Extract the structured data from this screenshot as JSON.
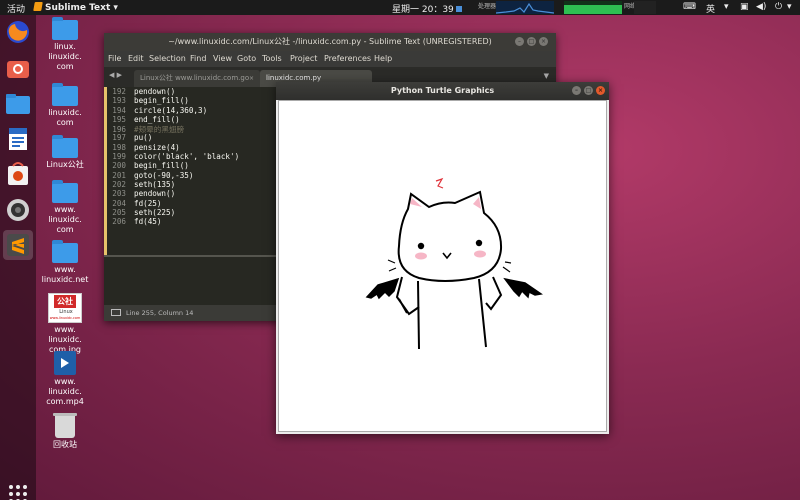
{
  "topbar": {
    "activities": "活动",
    "app_name": "Sublime Text",
    "clock": "星期一 20：39",
    "sysmon_labels": [
      "处理器",
      "网络"
    ],
    "lang": "英"
  },
  "dock": {
    "items": [
      "firefox-icon",
      "screenshot-icon",
      "files-icon",
      "writer-icon",
      "software-icon",
      "camera-icon",
      "sublime-icon"
    ]
  },
  "desktop": {
    "icons": [
      {
        "label": "linux.\nlinuxidc.\ncom",
        "type": "folder"
      },
      {
        "label": "linuxidc.\ncom",
        "type": "folder"
      },
      {
        "label": "Linux公社",
        "type": "folder"
      },
      {
        "label": "www.\nlinuxidc.\ncom",
        "type": "folder"
      },
      {
        "label": "www.\nlinuxidc.net",
        "type": "folder"
      },
      {
        "label": "www.\nlinuxidc.\ncom.jpg",
        "type": "image"
      },
      {
        "label": "www.\nlinuxidc.\ncom.mp4",
        "type": "video"
      },
      {
        "label": "回收站",
        "type": "trash"
      }
    ],
    "image_thumb_text": [
      "公社",
      "Linux",
      "www.linuxidc.com"
    ]
  },
  "sublime": {
    "title": "~/www.linuxidc.com/Linux公社 -/linuxidc.com.py - Sublime Text (UNREGISTERED)",
    "menu": [
      "File",
      "Edit",
      "Selection",
      "Find",
      "View",
      "Goto",
      "Tools",
      "Project",
      "Preferences",
      "Help"
    ],
    "tabs": [
      {
        "label": "Linux公社 www.linuxidc.com.go",
        "active": false
      },
      {
        "label": "linuxidc.com.py",
        "active": true
      }
    ],
    "code_lines": [
      {
        "n": "192",
        "text": "pendown()"
      },
      {
        "n": "193",
        "text": "begin_fill()"
      },
      {
        "n": "194",
        "text": "circle(14,360,3)"
      },
      {
        "n": "195",
        "text": "end_fill()"
      },
      {
        "n": "196",
        "text": "#颊晕的黑翅膀",
        "comment": true
      },
      {
        "n": "197",
        "text": "pu()"
      },
      {
        "n": "198",
        "text": "pensize(4)"
      },
      {
        "n": "199",
        "text": "color('black', 'black')"
      },
      {
        "n": "200",
        "text": "begin_fill()"
      },
      {
        "n": "201",
        "text": "goto(-90,-35)"
      },
      {
        "n": "202",
        "text": "seth(135)"
      },
      {
        "n": "203",
        "text": "pendown()"
      },
      {
        "n": "204",
        "text": "fd(25)"
      },
      {
        "n": "205",
        "text": "seth(225)"
      },
      {
        "n": "206",
        "text": "fd(45)"
      }
    ],
    "status": "Line 255, Column 14"
  },
  "turtle": {
    "title": "Python Turtle Graphics"
  },
  "colors": {
    "sublime_bg": "#272822",
    "blush": "#f6b6c6",
    "accent_red": "#e3592b"
  }
}
